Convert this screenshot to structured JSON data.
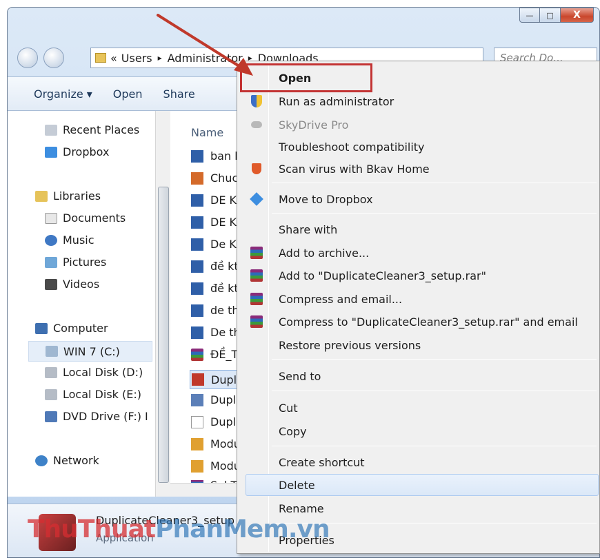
{
  "window": {
    "caption": {
      "minimize": "—",
      "maximize": "□",
      "close": "X"
    }
  },
  "address_bar": {
    "chevron": "«",
    "path": [
      "Users",
      "Administrator",
      "Downloads"
    ],
    "separator": "▸",
    "search_placeholder": "Search Do..."
  },
  "toolbar": {
    "organize": "Organize ▾",
    "open": "Open",
    "share": "Share"
  },
  "nav_pane": {
    "items": [
      {
        "label": "Recent Places",
        "icon": "recent-places-icon"
      },
      {
        "label": "Dropbox",
        "icon": "dropbox-icon"
      },
      {
        "label": "Libraries",
        "icon": "libraries-icon"
      },
      {
        "label": "Documents",
        "icon": "documents-icon"
      },
      {
        "label": "Music",
        "icon": "music-icon"
      },
      {
        "label": "Pictures",
        "icon": "pictures-icon"
      },
      {
        "label": "Videos",
        "icon": "videos-icon"
      },
      {
        "label": "Computer",
        "icon": "computer-icon"
      },
      {
        "label": "WIN 7 (C:)",
        "icon": "drive-icon"
      },
      {
        "label": "Local Disk (D:)",
        "icon": "drive-icon"
      },
      {
        "label": "Local Disk (E:)",
        "icon": "drive-icon"
      },
      {
        "label": "DVD Drive (F:) I",
        "icon": "dvd-drive-icon"
      },
      {
        "label": "Network",
        "icon": "network-icon"
      }
    ]
  },
  "file_list": {
    "column_name": "Name",
    "files": [
      "ban k",
      "Chuc",
      "DE KI",
      "DE KI",
      "De Ki",
      "đề kt",
      "đề kt",
      "de th",
      "De th",
      "ĐỀ_T",
      "Dupli",
      "Dupli",
      "Dupli",
      "Modu",
      "Modu",
      "Sel T"
    ]
  },
  "details_pane": {
    "filename": "DuplicateCleaner3_setup",
    "type": "Application"
  },
  "context_menu": {
    "items": [
      {
        "label": "Open",
        "bold": true
      },
      {
        "label": "Run as administrator",
        "icon": "shield-icon"
      },
      {
        "label": "SkyDrive Pro",
        "icon": "skydrive-icon",
        "disabled": true
      },
      {
        "label": "Troubleshoot compatibility"
      },
      {
        "label": "Scan virus with Bkav Home",
        "icon": "bkav-icon"
      },
      {
        "label": "Move to Dropbox",
        "icon": "dropbox-icon"
      },
      {
        "label": "Share with"
      },
      {
        "label": "Add to archive...",
        "icon": "winrar-icon"
      },
      {
        "label": "Add to \"DuplicateCleaner3_setup.rar\"",
        "icon": "winrar-icon"
      },
      {
        "label": "Compress and email...",
        "icon": "winrar-icon"
      },
      {
        "label": "Compress to \"DuplicateCleaner3_setup.rar\" and email",
        "icon": "winrar-icon"
      },
      {
        "label": "Restore previous versions"
      },
      {
        "label": "Send to"
      },
      {
        "label": "Cut"
      },
      {
        "label": "Copy"
      },
      {
        "label": "Create shortcut"
      },
      {
        "label": "Delete"
      },
      {
        "label": "Rename"
      },
      {
        "label": "Properties"
      }
    ]
  },
  "watermark": {
    "part1": "ThuThuat",
    "part2": "PhanMem.vn"
  },
  "colors": {
    "highlight": "#c33333",
    "arrow": "#c0392b",
    "menu_bg": "#f0f0f0",
    "selection": "#dce8f7"
  }
}
